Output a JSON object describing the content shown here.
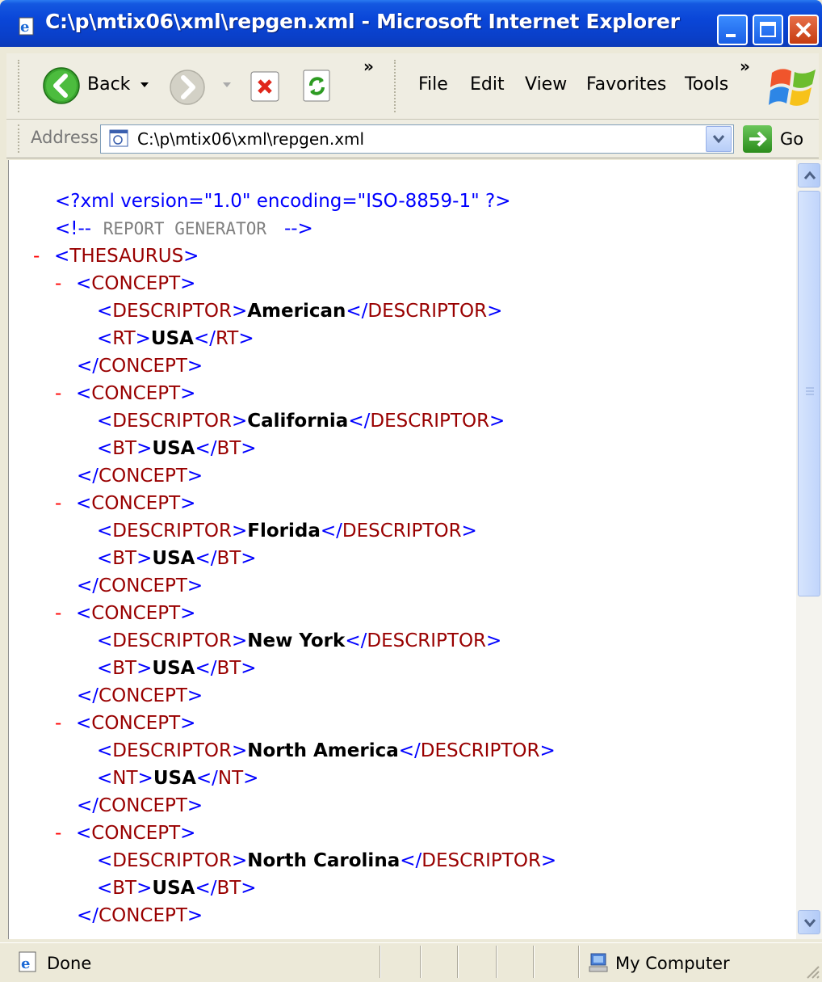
{
  "window": {
    "title": "C:\\p\\mtix06\\xml\\repgen.xml - Microsoft Internet Explorer",
    "controls": [
      "minimize",
      "maximize",
      "close"
    ]
  },
  "toolbar": {
    "back_label": "Back",
    "overflow_glyph": "»",
    "icons": [
      "back-arrow-icon",
      "forward-arrow-icon",
      "stop-icon",
      "refresh-icon",
      "windows-logo-icon"
    ]
  },
  "menu": {
    "items": [
      "File",
      "Edit",
      "View",
      "Favorites",
      "Tools"
    ],
    "overflow_glyph": "»"
  },
  "address": {
    "label": "Address",
    "value": "C:\\p\\mtix06\\xml\\repgen.xml",
    "go_label": "Go"
  },
  "document": {
    "pi": "<?xml version=\"1.0\" encoding=\"ISO-8859-1\" ?>",
    "comment_open": "<!--",
    "comment_text": "REPORT GENERATOR",
    "comment_close": "-->",
    "root_tag": "THESAURUS",
    "concept_tag": "CONCEPT",
    "concepts": [
      {
        "descriptor": "American",
        "rel_tag": "RT",
        "rel_value": "USA"
      },
      {
        "descriptor": "California",
        "rel_tag": "BT",
        "rel_value": "USA"
      },
      {
        "descriptor": "Florida",
        "rel_tag": "BT",
        "rel_value": "USA"
      },
      {
        "descriptor": "New York",
        "rel_tag": "BT",
        "rel_value": "USA"
      },
      {
        "descriptor": "North America",
        "rel_tag": "NT",
        "rel_value": "USA"
      },
      {
        "descriptor": "North Carolina",
        "rel_tag": "BT",
        "rel_value": "USA"
      }
    ],
    "descriptor_tag": "DESCRIPTOR"
  },
  "status": {
    "left_text": "Done",
    "zone_text": "My Computer"
  },
  "colors": {
    "markup_blue": "#0000ff",
    "tag_red": "#990000",
    "collapse_red": "#ff0000",
    "comment_gray": "#808080"
  }
}
